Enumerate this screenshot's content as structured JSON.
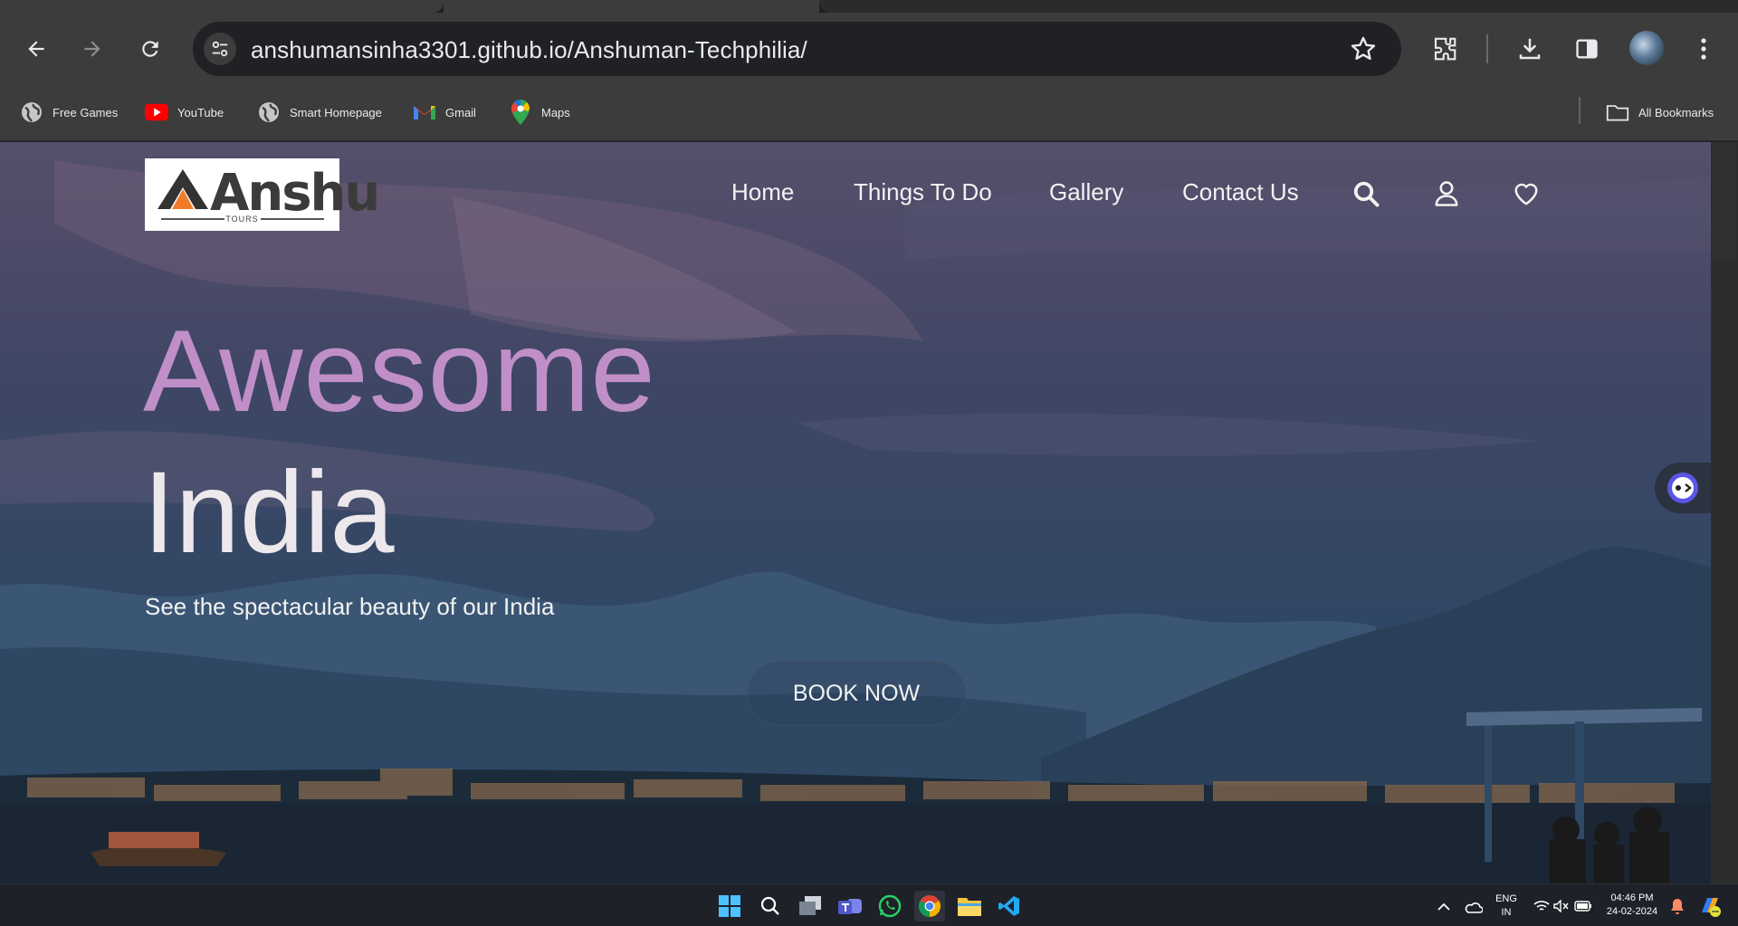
{
  "browser": {
    "url": "anshumansinha3301.github.io/Anshuman-Techphilia/",
    "bookmarks": [
      {
        "label": "Free Games",
        "icon": "globe-icon"
      },
      {
        "label": "YouTube",
        "icon": "youtube-icon"
      },
      {
        "label": "Smart Homepage",
        "icon": "globe-icon"
      },
      {
        "label": "Gmail",
        "icon": "gmail-icon"
      },
      {
        "label": "Maps",
        "icon": "maps-icon"
      }
    ],
    "all_bookmarks_label": "All Bookmarks"
  },
  "site": {
    "logo": {
      "word": "Anshu",
      "sub": "TOURS"
    },
    "nav": [
      "Home",
      "Things To Do",
      "Gallery",
      "Contact Us"
    ],
    "nav_icons": [
      "search-icon",
      "user-icon",
      "heart-icon"
    ],
    "hero": {
      "line1": "Awesome",
      "line2": "India",
      "subtitle": "See the spectacular beauty of our India",
      "cta": "BOOK NOW"
    },
    "colors": {
      "accent": "#c08fc8",
      "logo_orange": "#f07c2a"
    }
  },
  "taskbar": {
    "apps": [
      "windows-start-icon",
      "search-icon",
      "task-view-icon",
      "teams-icon",
      "whatsapp-icon",
      "chrome-icon",
      "file-explorer-icon",
      "vscode-icon"
    ],
    "lang_top": "ENG",
    "lang_bottom": "IN",
    "time": "04:46 PM",
    "date": "24-02-2024"
  }
}
